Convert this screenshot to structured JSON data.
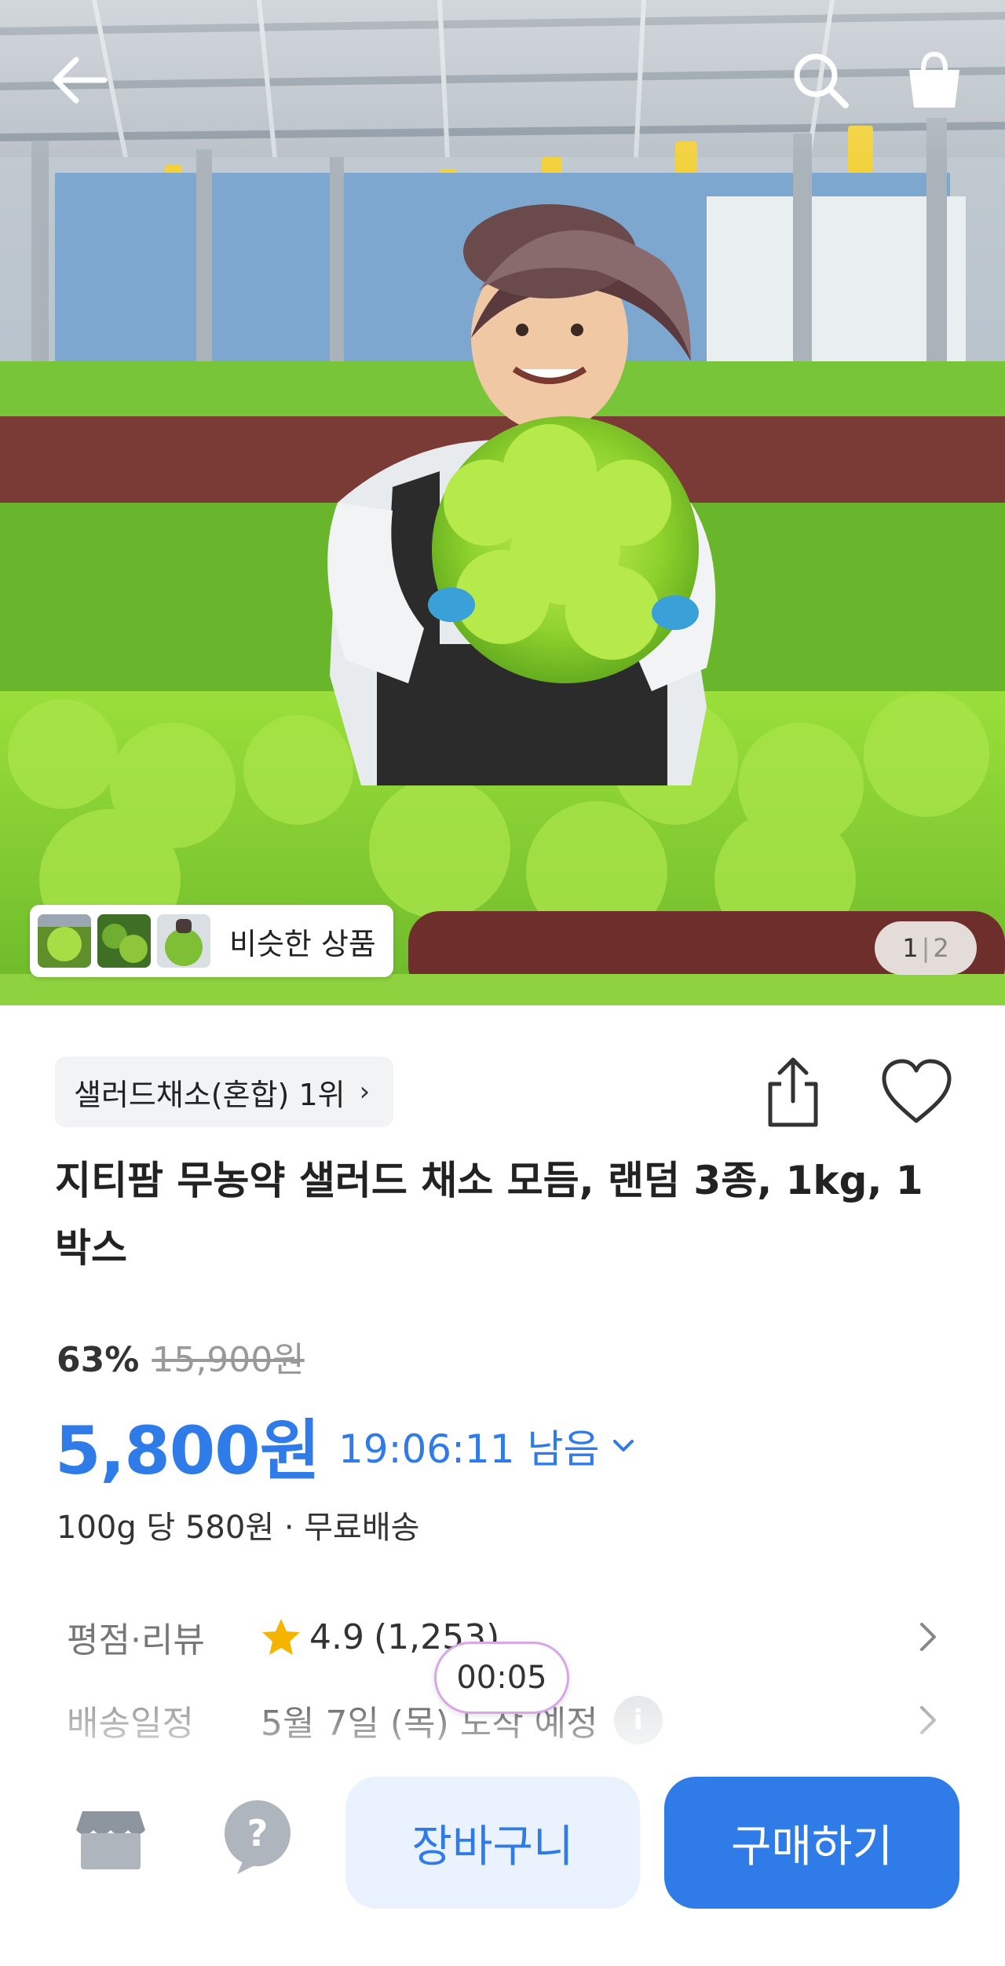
{
  "similar_products": {
    "label": "비슷한 상품"
  },
  "gallery": {
    "current": "1",
    "separator": "|",
    "total": "2"
  },
  "category_rank": {
    "label": "샐러드채소(혼합) 1위",
    "chevron": "›"
  },
  "product": {
    "title": "지티팜 무농약 샐러드 채소 모듬, 랜덤 3종, 1kg, 1박스"
  },
  "pricing": {
    "discount_rate": "63%",
    "original_price": "15,900원",
    "sale_price": "5,800원",
    "time_left": "19:06:11 남음",
    "unit_and_shipping": "100g 당 580원 · 무료배송"
  },
  "rating_row": {
    "label": "평점·리뷰",
    "rating": "4.9",
    "count": "(1,253)"
  },
  "delivery_row": {
    "label": "배송일정",
    "value": "5월 7일 (목) 도착 예정",
    "info": "i"
  },
  "overlay": {
    "recording_timer": "00:05"
  },
  "bottom_bar": {
    "help_glyph": "?",
    "cart_label": "장바구니",
    "buy_label": "구매하기"
  },
  "colors": {
    "accent": "#2f7be8",
    "accent_light": "#e9f2fd",
    "star": "#f5b400"
  },
  "icons": [
    "back-arrow-icon",
    "search-icon",
    "shopping-bag-icon",
    "share-icon",
    "heart-icon",
    "star-icon",
    "info-icon",
    "chevron-right-icon",
    "chevron-down-icon",
    "store-icon",
    "help-bubble-icon"
  ]
}
